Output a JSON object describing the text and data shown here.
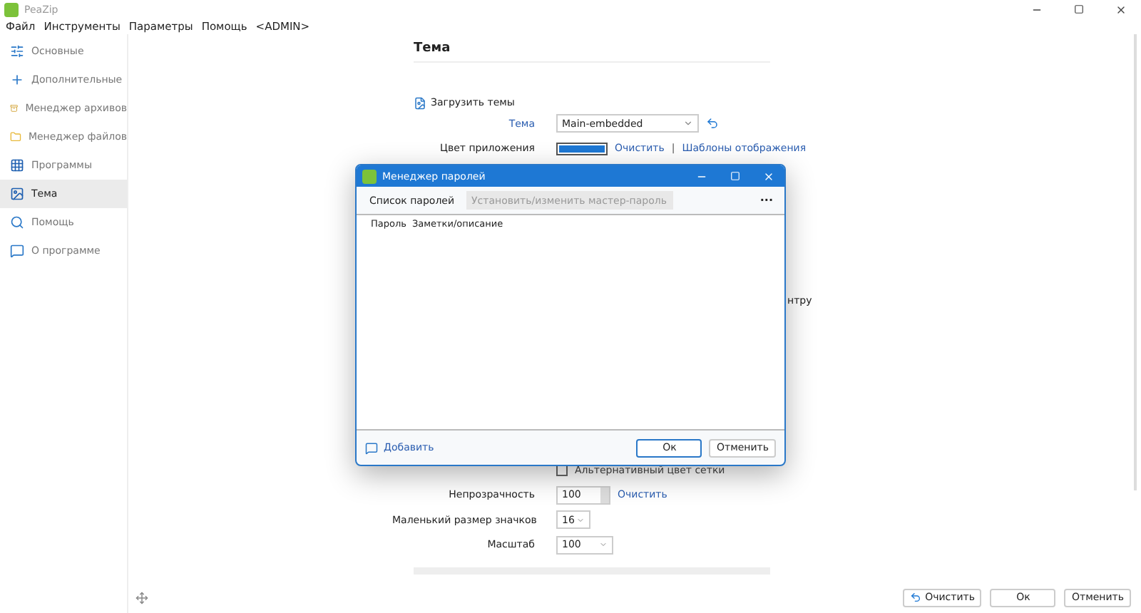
{
  "app_title": "PeaZip",
  "menu": [
    "Файл",
    "Инструменты",
    "Параметры",
    "Помощь",
    "<ADMIN>"
  ],
  "sidebar": [
    {
      "label": "Основные",
      "selected": false
    },
    {
      "label": "Дополнительные",
      "selected": false
    },
    {
      "label": "Менеджер архивов",
      "selected": false
    },
    {
      "label": "Менеджер файлов",
      "selected": false
    },
    {
      "label": "Программы",
      "selected": false
    },
    {
      "label": "Тема",
      "selected": true
    },
    {
      "label": "Помощь",
      "selected": false
    },
    {
      "label": "О программе",
      "selected": false
    }
  ],
  "page_title": "Тема",
  "load_themes": "Загрузить темы",
  "theme": {
    "label": "Тема",
    "value": "Main-embedded"
  },
  "app_color": {
    "label": "Цвет приложения",
    "clear": "Очистить",
    "separator": "|",
    "templates": "Шаблоны отображения"
  },
  "partial_text": "нтру",
  "alt_grid": {
    "label": "Альтернативный цвет сетки",
    "checked": false
  },
  "opacity": {
    "label": "Непрозрачность",
    "value": "100",
    "clear": "Очистить"
  },
  "small_icons": {
    "label": "Маленький размер значков",
    "value": "16"
  },
  "scale": {
    "label": "Масштаб",
    "value": "100"
  },
  "buttons": [
    {
      "label": "Очистить",
      "kind": "reset"
    },
    {
      "label": "Ок",
      "kind": "plain"
    },
    {
      "label": "Отменить",
      "kind": "plain"
    }
  ],
  "dialog": {
    "title": "Менеджер паролей",
    "tabs": [
      {
        "label": "Список паролей",
        "selected": true
      },
      {
        "label": "Установить/изменить мастер-пароль",
        "selected": false
      }
    ],
    "more": "···",
    "columns": [
      "Пароль",
      "Заметки/описание"
    ],
    "add": "Добавить",
    "buttons": [
      {
        "label": "Ок",
        "default": true
      },
      {
        "label": "Отменить",
        "default": false
      }
    ]
  }
}
